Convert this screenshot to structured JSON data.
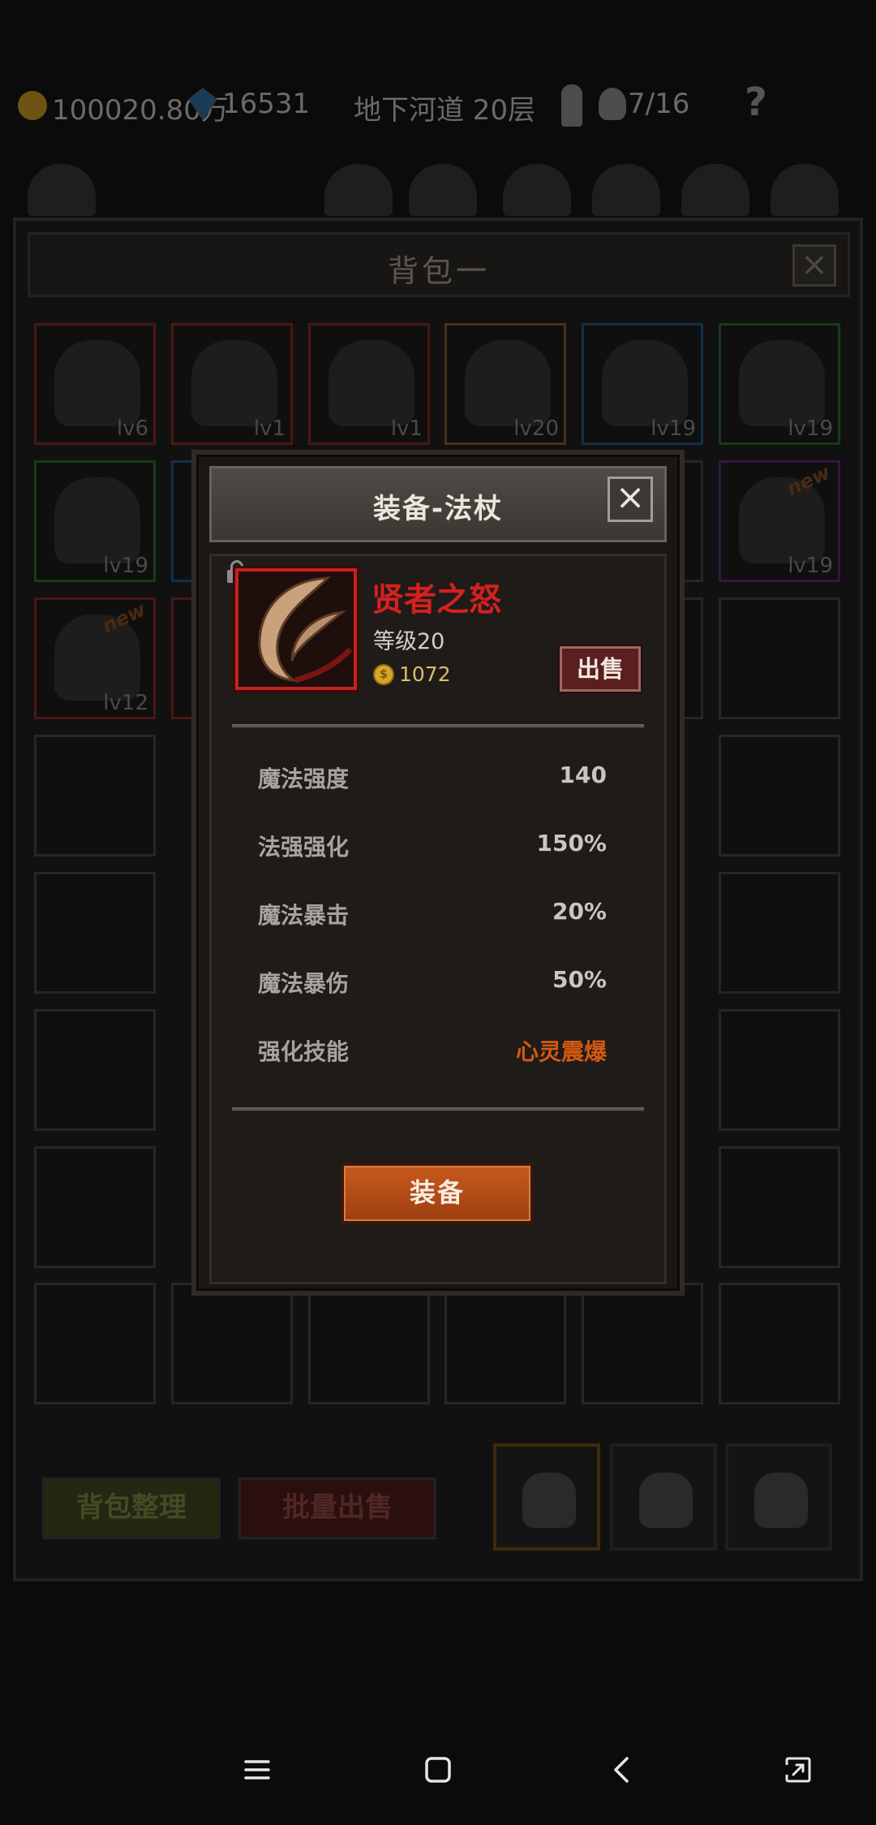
{
  "topbar": {
    "coins": "100020.80万",
    "gems": "16531",
    "location": "地下河道 20层",
    "keys_progress": "7/16",
    "help": "?"
  },
  "bag": {
    "title": "背包一",
    "close": "×",
    "slots": [
      {
        "level": "lv6",
        "rarity": "red",
        "icon": "helmet-icon"
      },
      {
        "level": "lv1",
        "rarity": "red",
        "icon": "gauntlet-icon"
      },
      {
        "level": "lv1",
        "rarity": "red",
        "icon": "shield-icon"
      },
      {
        "level": "lv20",
        "rarity": "orange",
        "icon": "sword-icon"
      },
      {
        "level": "lv19",
        "rarity": "blue",
        "icon": "armor-icon"
      },
      {
        "level": "lv19",
        "rarity": "green",
        "icon": "amulet-icon"
      },
      {
        "level": "lv19",
        "rarity": "green",
        "icon": "leather-helmet-icon"
      },
      {
        "level": "lv19",
        "rarity": "purple",
        "icon": "leather-helmet-icon",
        "new": "new"
      },
      {
        "level": "lv12",
        "rarity": "red",
        "icon": "necklace-icon",
        "new": "new"
      }
    ],
    "sort_button": "背包整理",
    "bulk_sell_button": "批量出售"
  },
  "dialog": {
    "title": "装备-法杖",
    "close": "×",
    "item": {
      "name": "贤者之怒",
      "level": "等级20",
      "price": "1072",
      "icon": "staff-claw-icon",
      "rarity_color": "#c8201e"
    },
    "sell_button": "出售",
    "stats": [
      {
        "label": "魔法强度",
        "value": "140"
      },
      {
        "label": "法强强化",
        "value": "150%"
      },
      {
        "label": "魔法暴击",
        "value": "20%"
      },
      {
        "label": "魔法暴伤",
        "value": "50%"
      },
      {
        "label": "强化技能",
        "value": "心灵震爆"
      }
    ],
    "equip_button": "装备"
  },
  "colors": {
    "accent_red": "#d4211f",
    "skill_orange": "#d35a12",
    "button_orange": "#c85a1d",
    "gold": "#d8bf6a"
  },
  "navbar": {
    "icons": [
      "menu-icon",
      "home-icon",
      "back-icon",
      "screenshot-icon"
    ]
  }
}
